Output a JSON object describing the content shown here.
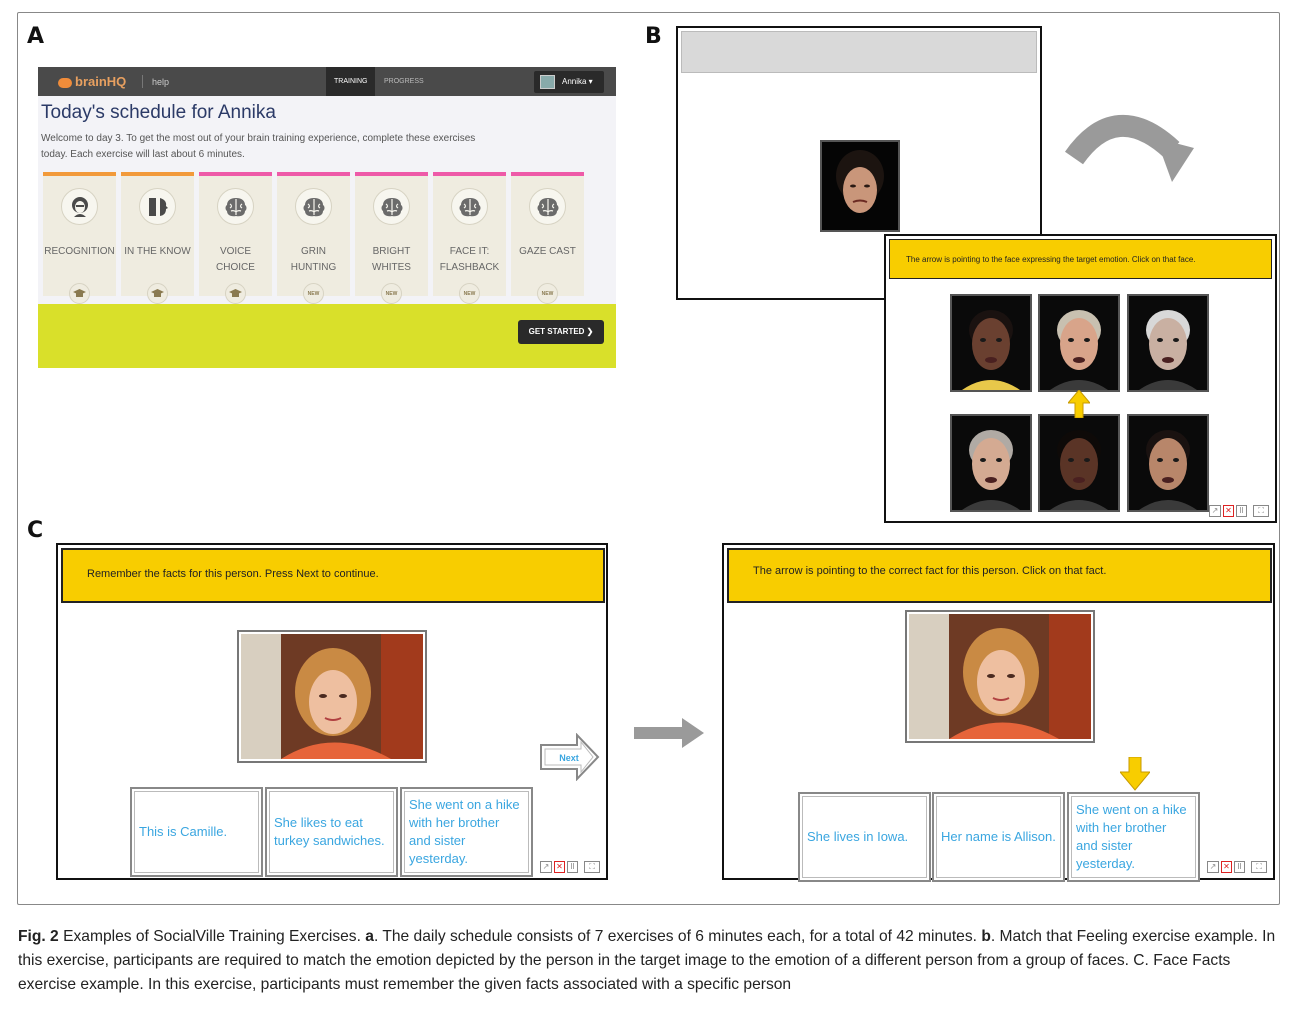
{
  "panel_letters": {
    "a": "A",
    "b": "B",
    "c": "C"
  },
  "brainhq": {
    "logo": "brainHQ",
    "help": "help",
    "tabs": [
      "TRAINING",
      "PROGRESS"
    ],
    "user": "Annika ▾",
    "title": "Today's schedule for Annika",
    "intro": "Welcome to day 3. To get the most out of your brain training experience, complete these exercises today. Each exercise will last about 6 minutes.",
    "exercises": [
      {
        "line1": "RECOGNITION",
        "line2": "",
        "badge": "",
        "accent": "#f29a3a",
        "icon": "face-icon"
      },
      {
        "line1": "IN THE KNOW",
        "line2": "",
        "badge": "",
        "accent": "#f29a3a",
        "icon": "faces-profile-icon"
      },
      {
        "line1": "VOICE",
        "line2": "CHOICE",
        "badge": "",
        "accent": "#ee5aa8",
        "icon": "brain-icon"
      },
      {
        "line1": "GRIN",
        "line2": "HUNTING",
        "badge": "NEW",
        "accent": "#ee5aa8",
        "icon": "brain-icon"
      },
      {
        "line1": "BRIGHT",
        "line2": "WHITES",
        "badge": "NEW",
        "accent": "#ee5aa8",
        "icon": "brain-icon"
      },
      {
        "line1": "FACE IT:",
        "line2": "FLASHBACK",
        "badge": "NEW",
        "accent": "#ee5aa8",
        "icon": "brain-icon"
      },
      {
        "line1": "GAZE CAST",
        "line2": "",
        "badge": "NEW",
        "accent": "#ee5aa8",
        "icon": "brain-icon"
      }
    ],
    "get_started": "GET STARTED ❯"
  },
  "match_feeling": {
    "instruction": "The arrow is pointing to the face expressing the target emotion. Click on that face."
  },
  "face_facts": {
    "left_instruction": "Remember the facts for this person.  Press Next to continue.",
    "next_label": "Next",
    "left_facts": [
      "This is Camille.",
      "She likes to eat turkey sandwiches.",
      "She went on a hike with her brother and sister yesterday."
    ],
    "right_instruction": "The arrow is pointing to the correct fact for this person. Click on that fact.",
    "right_facts": [
      "She lives in Iowa.",
      "Her name is Allison.",
      "She went on a hike with her brother and sister yesterday."
    ]
  },
  "toolbar": {
    "chart": "↗",
    "close": "✕",
    "pause": "II",
    "fullscreen": "⛶"
  },
  "caption": {
    "fig_label": "Fig. 2",
    "title": "Examples of SocialVille Training Exercises.",
    "a_label": "a",
    "a_text": ". The daily schedule consists of 7 exercises of 6 minutes each, for a total of 42 minutes.",
    "b_label": "b",
    "b_text": ". Match that Feeling exercise example. In this exercise, participants are required to match the emotion depicted by the person in the target image to the emotion of a different person from a group of faces. C. Face Facts exercise example. In this exercise, participants must remember the given facts associated with a specific person"
  },
  "colors": {
    "instruction_yellow": "#f8cd00",
    "fact_blue": "#3aa6e0",
    "brainhq_lime": "#d9e02a",
    "gesture_arrow_grey": "#9a9a9a"
  }
}
